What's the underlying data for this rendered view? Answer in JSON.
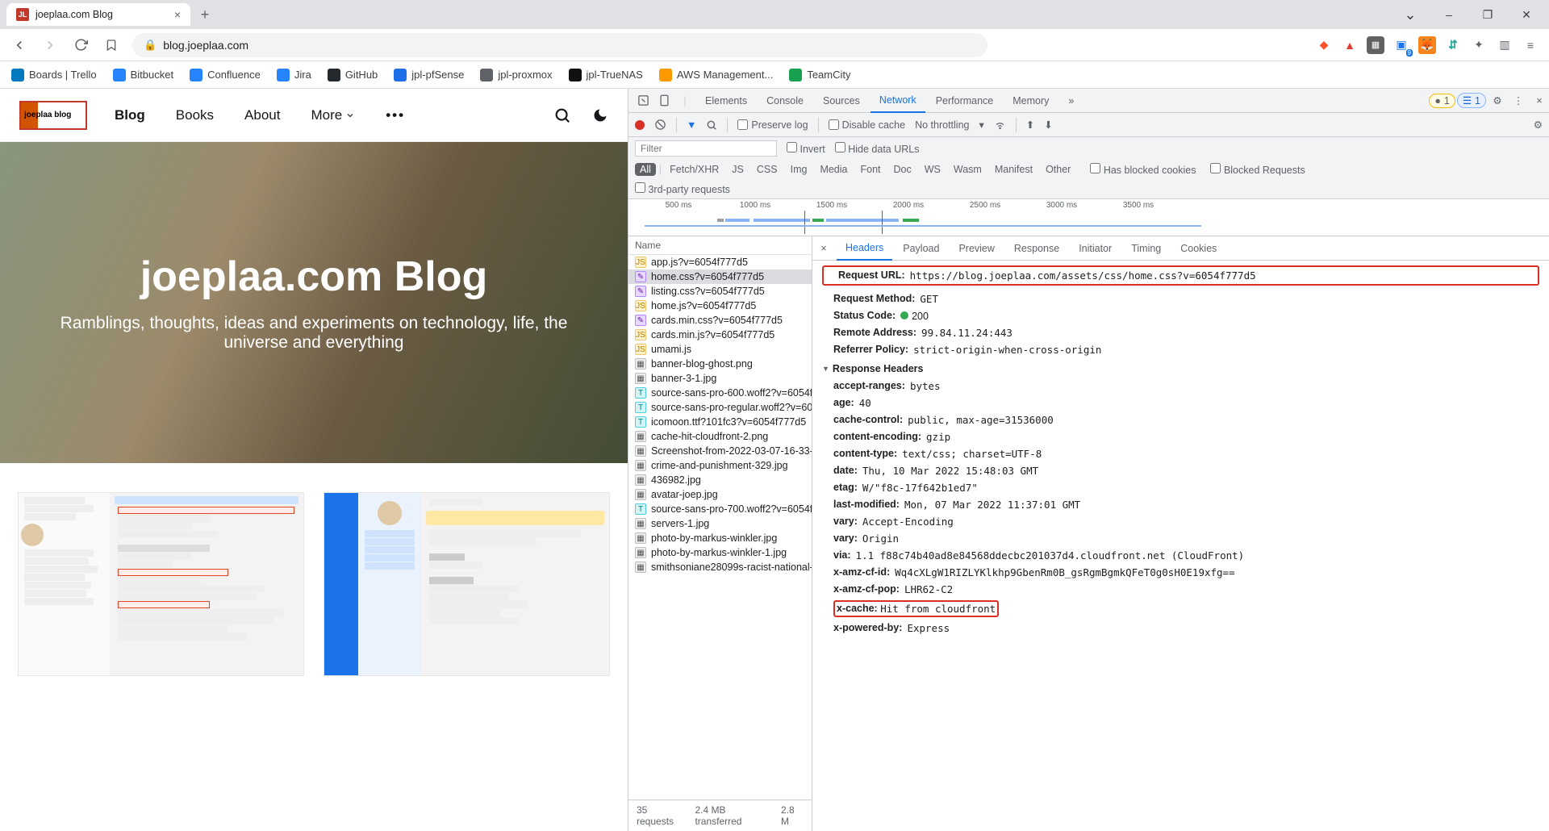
{
  "tab": {
    "title": "joeplaa.com Blog"
  },
  "url": "blog.joeplaa.com",
  "window": {
    "min": "–",
    "max": "❐",
    "close": "✕",
    "chev": "⌄"
  },
  "bookmarks": [
    {
      "label": "Boards | Trello",
      "color": "#0079bf"
    },
    {
      "label": "Bitbucket",
      "color": "#2684ff"
    },
    {
      "label": "Confluence",
      "color": "#2684ff"
    },
    {
      "label": "Jira",
      "color": "#2684ff"
    },
    {
      "label": "GitHub",
      "color": "#24292e"
    },
    {
      "label": "jpl-pfSense",
      "color": "#1f6feb"
    },
    {
      "label": "jpl-proxmox",
      "color": "#5f6368"
    },
    {
      "label": "jpl-TrueNAS",
      "color": "#111"
    },
    {
      "label": "AWS Management...",
      "color": "#ff9900"
    },
    {
      "label": "TeamCity",
      "color": "#18a14f"
    }
  ],
  "site": {
    "logo_text": "joeplaa blog",
    "nav": {
      "blog": "Blog",
      "books": "Books",
      "about": "About",
      "more": "More"
    },
    "hero_title": "joeplaa.com Blog",
    "hero_sub": "Ramblings, thoughts, ideas and experiments on technology, life, the universe and everything"
  },
  "devtools": {
    "tabs": [
      "Elements",
      "Console",
      "Sources",
      "Network",
      "Performance",
      "Memory"
    ],
    "active_tab": "Network",
    "more": "»",
    "warn_count": "1",
    "issue_count": "1",
    "toolbar": {
      "preserve": "Preserve log",
      "disable": "Disable cache",
      "throttle": "No throttling"
    },
    "filter": {
      "placeholder": "Filter",
      "invert": "Invert",
      "hide": "Hide data URLs",
      "chips": [
        "All",
        "Fetch/XHR",
        "JS",
        "CSS",
        "Img",
        "Media",
        "Font",
        "Doc",
        "WS",
        "Wasm",
        "Manifest",
        "Other"
      ],
      "blocked_cookies": "Has blocked cookies",
      "blocked_req": "Blocked Requests",
      "third": "3rd-party requests"
    },
    "timeline_ticks": [
      "500 ms",
      "1000 ms",
      "1500 ms",
      "2000 ms",
      "2500 ms",
      "3000 ms",
      "3500 ms"
    ],
    "req_header": "Name",
    "requests": [
      {
        "name": "app.js?v=6054f777d5",
        "type": "js"
      },
      {
        "name": "home.css?v=6054f777d5",
        "type": "css",
        "selected": true
      },
      {
        "name": "listing.css?v=6054f777d5",
        "type": "css"
      },
      {
        "name": "home.js?v=6054f777d5",
        "type": "js"
      },
      {
        "name": "cards.min.css?v=6054f777d5",
        "type": "css"
      },
      {
        "name": "cards.min.js?v=6054f777d5",
        "type": "js"
      },
      {
        "name": "umami.js",
        "type": "js"
      },
      {
        "name": "banner-blog-ghost.png",
        "type": "img"
      },
      {
        "name": "banner-3-1.jpg",
        "type": "img"
      },
      {
        "name": "source-sans-pro-600.woff2?v=6054f...",
        "type": "font"
      },
      {
        "name": "source-sans-pro-regular.woff2?v=60...",
        "type": "font"
      },
      {
        "name": "icomoon.ttf?101fc3?v=6054f777d5",
        "type": "font"
      },
      {
        "name": "cache-hit-cloudfront-2.png",
        "type": "img"
      },
      {
        "name": "Screenshot-from-2022-03-07-16-33-...",
        "type": "img"
      },
      {
        "name": "crime-and-punishment-329.jpg",
        "type": "img"
      },
      {
        "name": "436982.jpg",
        "type": "img"
      },
      {
        "name": "avatar-joep.jpg",
        "type": "img"
      },
      {
        "name": "source-sans-pro-700.woff2?v=6054f...",
        "type": "font"
      },
      {
        "name": "servers-1.jpg",
        "type": "img"
      },
      {
        "name": "photo-by-markus-winkler.jpg",
        "type": "img"
      },
      {
        "name": "photo-by-markus-winkler-1.jpg",
        "type": "img"
      },
      {
        "name": "smithsoniane28099s-racist-national-...",
        "type": "img"
      }
    ],
    "status": {
      "requests": "35 requests",
      "transferred": "2.4 MB transferred",
      "resources": "2.8 M"
    },
    "detail_tabs": [
      "Headers",
      "Payload",
      "Preview",
      "Response",
      "Initiator",
      "Timing",
      "Cookies"
    ],
    "detail_active": "Headers",
    "general": {
      "request_url_k": "Request URL:",
      "request_url_v": "https://blog.joeplaa.com/assets/css/home.css?v=6054f777d5",
      "method_k": "Request Method:",
      "method_v": "GET",
      "status_k": "Status Code:",
      "status_v": "200",
      "remote_k": "Remote Address:",
      "remote_v": "99.84.11.24:443",
      "referrer_k": "Referrer Policy:",
      "referrer_v": "strict-origin-when-cross-origin"
    },
    "response_h": "Response Headers",
    "response": [
      {
        "k": "accept-ranges:",
        "v": "bytes"
      },
      {
        "k": "age:",
        "v": "40"
      },
      {
        "k": "cache-control:",
        "v": "public, max-age=31536000"
      },
      {
        "k": "content-encoding:",
        "v": "gzip"
      },
      {
        "k": "content-type:",
        "v": "text/css; charset=UTF-8"
      },
      {
        "k": "date:",
        "v": "Thu, 10 Mar 2022 15:48:03 GMT"
      },
      {
        "k": "etag:",
        "v": "W/\"f8c-17f642b1ed7\""
      },
      {
        "k": "last-modified:",
        "v": "Mon, 07 Mar 2022 11:37:01 GMT"
      },
      {
        "k": "vary:",
        "v": "Accept-Encoding"
      },
      {
        "k": "vary:",
        "v": "Origin"
      },
      {
        "k": "via:",
        "v": "1.1 f88c74b40ad8e84568ddecbc201037d4.cloudfront.net (CloudFront)"
      },
      {
        "k": "x-amz-cf-id:",
        "v": "Wq4cXLgW1RIZLYKlkhp9GbenRm0B_gsRgmBgmkQFeT0g0sH0E19xfg=="
      },
      {
        "k": "x-amz-cf-pop:",
        "v": "LHR62-C2"
      },
      {
        "k": "x-cache:",
        "v": "Hit from cloudfront",
        "hl": true
      },
      {
        "k": "x-powered-by:",
        "v": "Express"
      }
    ]
  }
}
